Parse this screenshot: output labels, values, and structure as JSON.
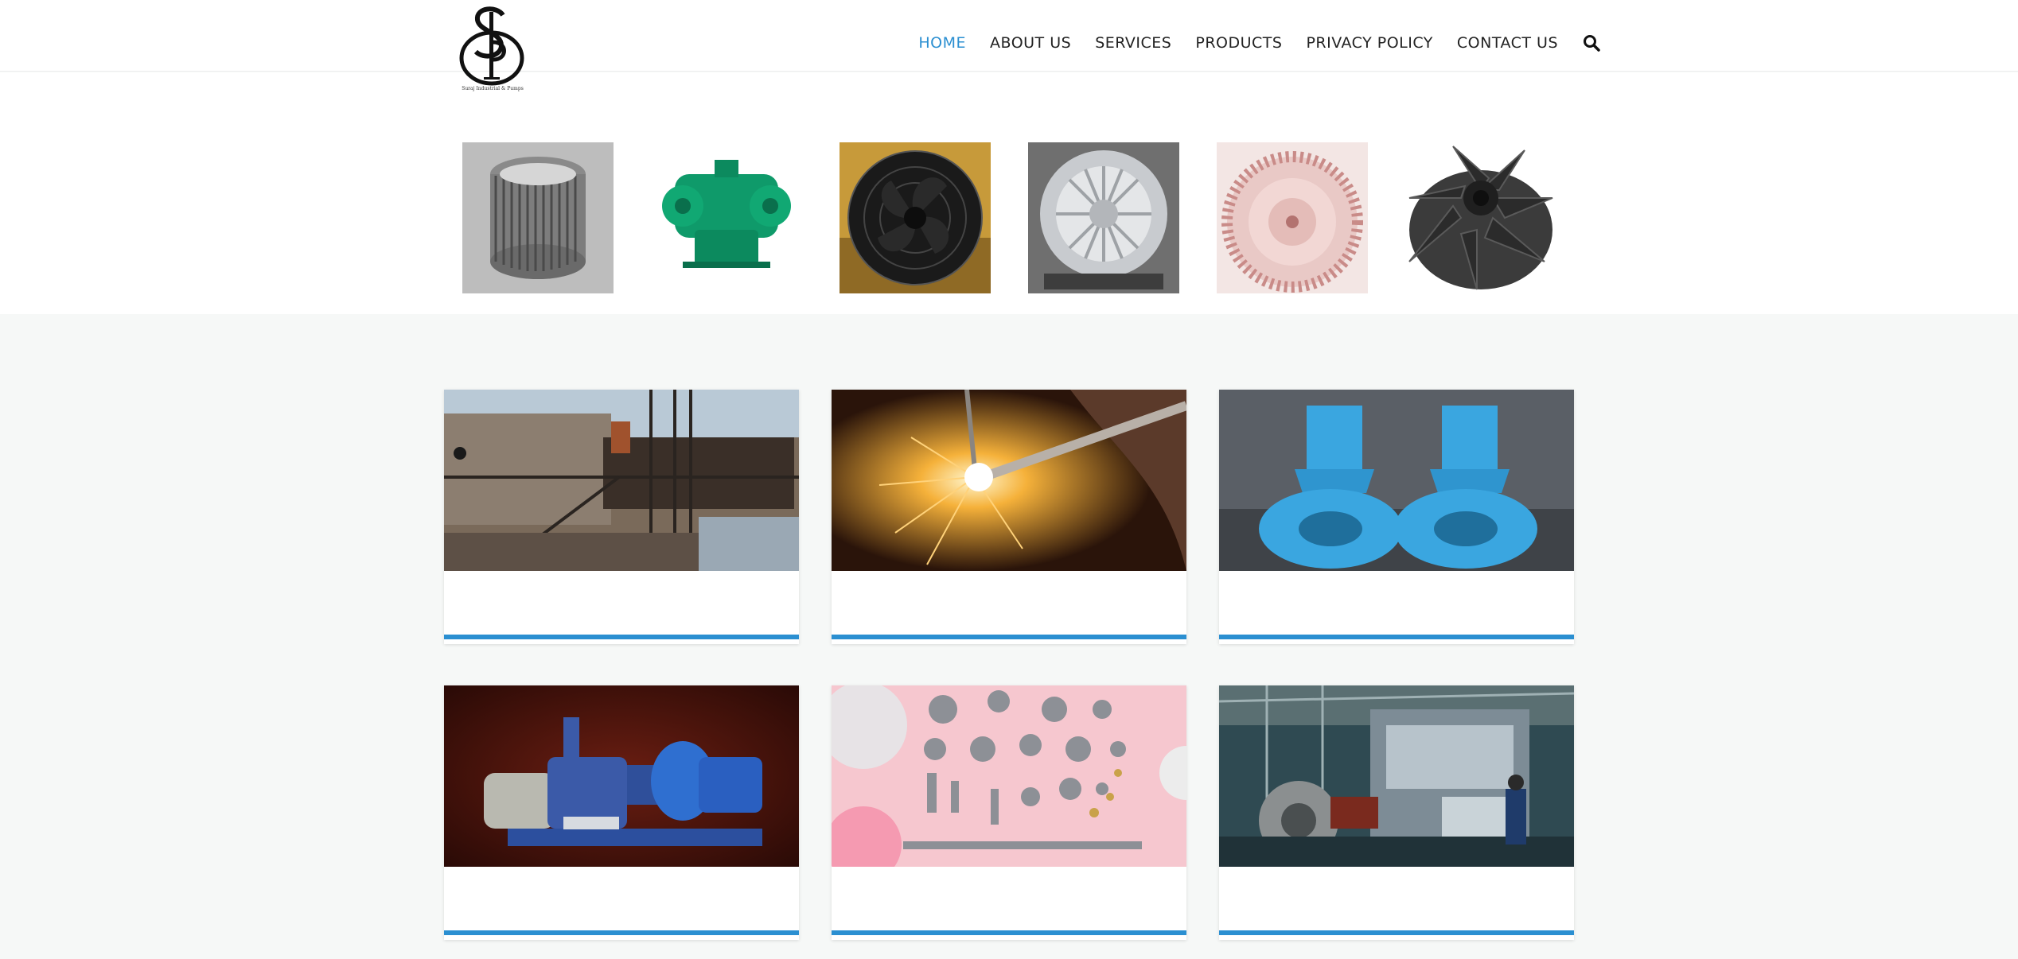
{
  "brand": {
    "logo_letters": "S I P",
    "caption": "Suraj Industrial & Pumps"
  },
  "nav": {
    "items": [
      {
        "label": "HOME",
        "active": true
      },
      {
        "label": "ABOUT US",
        "active": false
      },
      {
        "label": "SERVICES",
        "active": false
      },
      {
        "label": "PRODUCTS",
        "active": false
      },
      {
        "label": "PRIVACY POLICY",
        "active": false
      },
      {
        "label": "CONTACT US",
        "active": false
      }
    ],
    "search_icon": "search-icon"
  },
  "product_strip": [
    {
      "icon": "blower-wheel-image"
    },
    {
      "icon": "roots-blower-image"
    },
    {
      "icon": "axial-fan-image"
    },
    {
      "icon": "ring-blower-image"
    },
    {
      "icon": "centrifugal-impeller-image"
    },
    {
      "icon": "turbo-impeller-image"
    }
  ],
  "cards": [
    {
      "image": "industrial-plant-image"
    },
    {
      "image": "welding-sparks-image"
    },
    {
      "image": "blue-blowers-image"
    },
    {
      "image": "pump-set-image"
    },
    {
      "image": "machined-parts-image"
    },
    {
      "image": "factory-machine-image"
    }
  ],
  "colors": {
    "accent": "#2b8fd1",
    "page_background": "#f6f8f7",
    "header_background": "#ffffff"
  }
}
